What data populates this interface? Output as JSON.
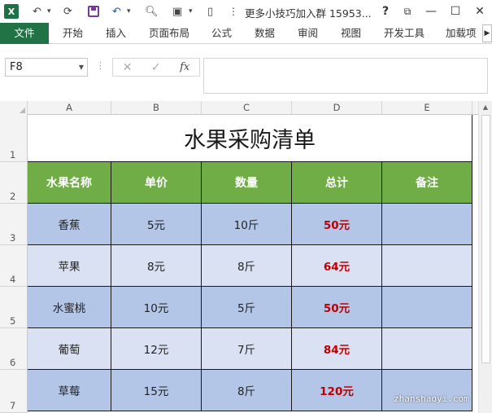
{
  "titlebar": {
    "app_icon": "excel-logo",
    "window_title": "更多小技巧加入群 15953...",
    "buttons": [
      "help",
      "ribbon-display",
      "minimize",
      "maximize",
      "close"
    ]
  },
  "ribbon": {
    "tabs": [
      "文件",
      "开始",
      "插入",
      "页面布局",
      "公式",
      "数据",
      "审阅",
      "视图",
      "开发工具",
      "加载项"
    ]
  },
  "formula_bar": {
    "name_box": "F8",
    "fx_label": "fx",
    "formula_value": ""
  },
  "columns": [
    "A",
    "B",
    "C",
    "D",
    "E"
  ],
  "rows": [
    "1",
    "2",
    "3",
    "4",
    "5",
    "6",
    "7"
  ],
  "sheet": {
    "title": "水果采购清单",
    "headers": [
      "水果名称",
      "单价",
      "数量",
      "总计",
      "备注"
    ],
    "data": [
      [
        "香蕉",
        "5元",
        "10斤",
        "50元",
        ""
      ],
      [
        "苹果",
        "8元",
        "8斤",
        "64元",
        ""
      ],
      [
        "水蜜桃",
        "10元",
        "5斤",
        "50元",
        ""
      ],
      [
        "葡萄",
        "12元",
        "7斤",
        "84元",
        ""
      ],
      [
        "草莓",
        "15元",
        "8斤",
        "120元",
        ""
      ]
    ]
  },
  "colors": {
    "header_green": "#70ad47",
    "band_dark": "#b4c6e7",
    "band_light": "#d9e1f2",
    "total_red": "#c00000",
    "file_tab": "#217346"
  },
  "watermark": "zhanshaoyi.com"
}
